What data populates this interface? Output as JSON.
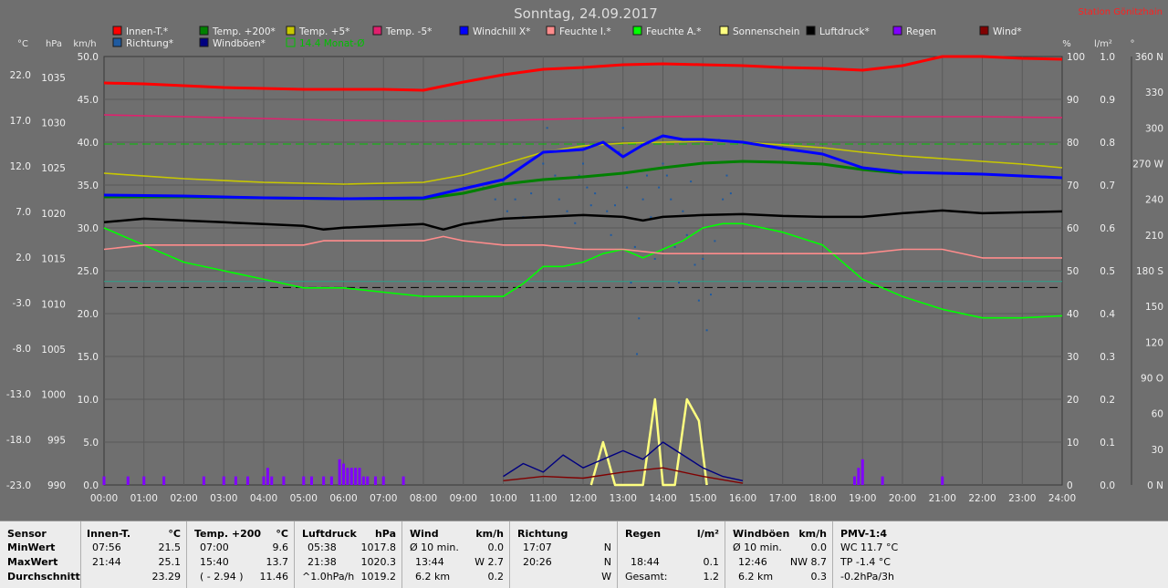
{
  "chart_data": {
    "type": "line",
    "title": "Sonntag, 24.09.2017",
    "station": "Station Gönitzhain",
    "x_ticks": [
      "00:00",
      "01:00",
      "02:00",
      "03:00",
      "04:00",
      "05:00",
      "06:00",
      "07:00",
      "08:00",
      "09:00",
      "10:00",
      "11:00",
      "12:00",
      "13:00",
      "14:00",
      "15:00",
      "16:00",
      "17:00",
      "18:00",
      "19:00",
      "20:00",
      "21:00",
      "22:00",
      "23:00",
      "24:00"
    ],
    "axes_left": {
      "temp_unit": "°C",
      "temp_ticks": [
        "22.0",
        "17.0",
        "12.0",
        "7.0",
        "2.0",
        "-3.0",
        "-8.0",
        "-13.0",
        "-18.0",
        "-23.0"
      ],
      "pressure_unit": "hPa",
      "pressure_ticks": [
        "1035",
        "1030",
        "1025",
        "1020",
        "1015",
        "1010",
        "1005",
        "1000",
        "995",
        "990"
      ],
      "wind_unit": "km/h",
      "wind_ticks": [
        "50.0",
        "45.0",
        "40.0",
        "35.0",
        "30.0",
        "25.0",
        "20.0",
        "15.0",
        "10.0",
        "5.0",
        "0.0"
      ]
    },
    "axes_right": {
      "humidity_unit": "%",
      "humidity_ticks": [
        "100",
        "90",
        "80",
        "70",
        "60",
        "50",
        "40",
        "30",
        "20",
        "10",
        "0"
      ],
      "rain_unit": "l/m²",
      "rain_ticks": [
        "1.0",
        "0.9",
        "0.8",
        "0.7",
        "0.6",
        "0.5",
        "0.4",
        "0.3",
        "0.2",
        "0.1",
        "0.0"
      ],
      "dir_unit": "°",
      "dir_ticks": [
        "360 N",
        "330",
        "300",
        "270 W",
        "240",
        "210",
        "180 S",
        "150",
        "120",
        "90 O",
        "60",
        "30",
        "0 N"
      ]
    },
    "legend": [
      {
        "label": "Innen-T.*",
        "color": "#ff0000"
      },
      {
        "label": "Temp. +200*",
        "color": "#008000"
      },
      {
        "label": "Temp. +5*",
        "color": "#c8c800"
      },
      {
        "label": "Temp. -5*",
        "color": "#e0206e"
      },
      {
        "label": "Windchill X*",
        "color": "#0000ff"
      },
      {
        "label": "Feuchte I.*",
        "color": "#ff8c8c"
      },
      {
        "label": "Feuchte A.*",
        "color": "#00ff00"
      },
      {
        "label": "Sonnenschein",
        "color": "#ffff80"
      },
      {
        "label": "Luftdruck*",
        "color": "#000000"
      },
      {
        "label": "Regen",
        "color": "#8000ff"
      },
      {
        "label": "Wind*",
        "color": "#800000"
      },
      {
        "label": "Richtung*",
        "color": "#1e5aa0"
      },
      {
        "label": "Windböen*",
        "color": "#000080"
      },
      {
        "label": "14.4 Monat-Ø",
        "color": "#00c000"
      }
    ],
    "series": [
      {
        "name": "Innen-T.*",
        "unit": "°C",
        "x": [
          0,
          1,
          2,
          3,
          4,
          5,
          6,
          7,
          8,
          9,
          10,
          11,
          12,
          13,
          14,
          15,
          16,
          17,
          18,
          19,
          20,
          21,
          22,
          23,
          24
        ],
        "values": [
          21.1,
          21.0,
          20.8,
          20.6,
          20.5,
          20.4,
          20.4,
          20.4,
          20.3,
          21.2,
          22.0,
          22.6,
          22.8,
          23.1,
          23.2,
          23.1,
          23.0,
          22.8,
          22.7,
          22.5,
          23.0,
          24.0,
          24.0,
          23.8,
          23.7
        ]
      },
      {
        "name": "Temp. +5*",
        "unit": "°C",
        "x": [
          0,
          2,
          4,
          6,
          8,
          9,
          10,
          11,
          12,
          13,
          14,
          15,
          16,
          17,
          18,
          19,
          20,
          21,
          22,
          23,
          24
        ],
        "values": [
          11.2,
          10.6,
          10.2,
          10.0,
          10.2,
          11.0,
          12.2,
          13.5,
          14.2,
          14.5,
          14.6,
          14.7,
          14.6,
          14.3,
          14.0,
          13.5,
          13.1,
          12.8,
          12.5,
          12.2,
          11.8
        ]
      },
      {
        "name": "Temp. -5*",
        "unit": "°C",
        "x": [
          0,
          2,
          4,
          6,
          8,
          10,
          12,
          14,
          16,
          18,
          20,
          22,
          24
        ],
        "values": [
          17.6,
          17.4,
          17.2,
          17.0,
          16.9,
          17.0,
          17.2,
          17.4,
          17.5,
          17.5,
          17.4,
          17.4,
          17.3
        ]
      },
      {
        "name": "Temp. +200*",
        "unit": "°C",
        "x": [
          0,
          2,
          4,
          6,
          8,
          9,
          10,
          11,
          12,
          13,
          14,
          15,
          16,
          17,
          18,
          19,
          20
        ],
        "values": [
          8.6,
          8.6,
          8.5,
          8.4,
          8.4,
          9.0,
          10.0,
          10.5,
          10.8,
          11.2,
          11.8,
          12.3,
          12.5,
          12.4,
          12.2,
          11.6,
          11.2
        ]
      },
      {
        "name": "Windchill X*",
        "unit": "°C",
        "x": [
          0,
          2,
          4,
          6,
          8,
          9,
          10,
          10.5,
          11,
          12,
          12.5,
          13,
          13.5,
          14,
          14.5,
          15,
          16,
          17,
          18,
          19,
          20,
          22,
          24
        ],
        "values": [
          8.8,
          8.7,
          8.5,
          8.4,
          8.5,
          9.5,
          10.5,
          12.0,
          13.5,
          13.8,
          14.6,
          13.0,
          14.3,
          15.3,
          14.9,
          14.9,
          14.6,
          13.9,
          13.3,
          11.8,
          11.3,
          11.1,
          10.7
        ]
      },
      {
        "name": "Luftdruck*",
        "unit": "hPa",
        "x": [
          0,
          1,
          2,
          3,
          4,
          5,
          5.5,
          6,
          7,
          8,
          8.5,
          9,
          10,
          11,
          12,
          13,
          13.5,
          14,
          15,
          16,
          17,
          18,
          19,
          20,
          21,
          22,
          23,
          24
        ],
        "values": [
          1019.0,
          1019.4,
          1019.2,
          1019.0,
          1018.8,
          1018.6,
          1018.2,
          1018.4,
          1018.6,
          1018.8,
          1018.2,
          1018.8,
          1019.4,
          1019.6,
          1019.8,
          1019.6,
          1019.2,
          1019.6,
          1019.8,
          1019.9,
          1019.7,
          1019.6,
          1019.6,
          1020.0,
          1020.3,
          1020.0,
          1020.1,
          1020.2
        ]
      },
      {
        "name": "Feuchte I.*",
        "unit": "%",
        "x": [
          0,
          1,
          2,
          3,
          4,
          5,
          5.5,
          6,
          7,
          8,
          8.5,
          9,
          10,
          11,
          12,
          13,
          14,
          15,
          16,
          17,
          18,
          19,
          20,
          21,
          22,
          23,
          24
        ],
        "values": [
          55,
          56,
          56,
          56,
          56,
          56,
          57,
          57,
          57,
          57,
          58,
          57,
          56,
          56,
          55,
          55,
          54,
          54,
          54,
          54,
          54,
          54,
          55,
          55,
          53,
          53,
          53
        ]
      },
      {
        "name": "Feuchte A.*",
        "unit": "%",
        "x": [
          0,
          1,
          2,
          3,
          4,
          5,
          6,
          7,
          8,
          9,
          10,
          10.5,
          11,
          11.5,
          12,
          12.5,
          13,
          13.5,
          14,
          14.5,
          15,
          15.5,
          16,
          17,
          18,
          19,
          20,
          21,
          22,
          23,
          24
        ],
        "values": [
          60,
          56,
          52,
          50,
          48,
          46,
          46,
          45,
          44,
          44,
          44,
          47,
          51,
          51,
          52,
          54,
          55,
          53,
          55,
          57,
          60,
          61,
          61,
          59,
          56,
          48,
          44,
          41,
          39,
          39,
          39.5
        ]
      },
      {
        "name": "Sonnenschein",
        "unit": "%",
        "x": [
          12.2,
          12.5,
          12.8,
          13.5,
          13.8,
          14.0,
          14.3,
          14.6,
          14.9,
          15.1
        ],
        "values": [
          0,
          10,
          0,
          0,
          20,
          0,
          0,
          20,
          15,
          0
        ]
      },
      {
        "name": "Wind*",
        "unit": "km/h",
        "x": [
          10,
          11,
          12,
          13,
          14,
          15,
          16
        ],
        "values": [
          0.5,
          1.0,
          0.8,
          1.5,
          2.0,
          1.0,
          0.2
        ]
      },
      {
        "name": "Windböen*",
        "unit": "km/h",
        "x": [
          10,
          10.5,
          11,
          11.5,
          12,
          12.5,
          13,
          13.5,
          14,
          14.5,
          15,
          15.5,
          16
        ],
        "values": [
          1.0,
          2.5,
          1.5,
          3.5,
          2.0,
          3.0,
          4.0,
          3.0,
          5.0,
          3.5,
          2.0,
          1.0,
          0.5
        ]
      },
      {
        "name": "Regen",
        "unit": "l/m²",
        "x": [
          0,
          0.6,
          1.0,
          1.5,
          2.5,
          3.0,
          3.3,
          3.6,
          4.0,
          4.1,
          4.2,
          4.5,
          5.0,
          5.2,
          5.5,
          5.7,
          5.9,
          6.0,
          6.1,
          6.2,
          6.3,
          6.4,
          6.5,
          6.6,
          6.8,
          7.0,
          7.5,
          18.8,
          18.9,
          19.0,
          19.5,
          21.0
        ],
        "values": [
          0.02,
          0.02,
          0.02,
          0.02,
          0.02,
          0.02,
          0.02,
          0.02,
          0.02,
          0.04,
          0.02,
          0.02,
          0.02,
          0.02,
          0.02,
          0.02,
          0.06,
          0.05,
          0.04,
          0.04,
          0.04,
          0.04,
          0.02,
          0.02,
          0.02,
          0.02,
          0.02,
          0.02,
          0.04,
          0.06,
          0.02,
          0.02
        ]
      }
    ],
    "direction_scatter": [
      [
        9.5,
        250
      ],
      [
        9.8,
        240
      ],
      [
        10.0,
        255
      ],
      [
        10.1,
        230
      ],
      [
        10.3,
        240
      ],
      [
        10.5,
        225
      ],
      [
        10.7,
        245
      ],
      [
        11.0,
        270
      ],
      [
        11.1,
        300
      ],
      [
        11.2,
        280
      ],
      [
        11.3,
        260
      ],
      [
        11.4,
        240
      ],
      [
        11.6,
        230
      ],
      [
        11.8,
        220
      ],
      [
        11.9,
        260
      ],
      [
        12.0,
        270
      ],
      [
        12.1,
        250
      ],
      [
        12.2,
        235
      ],
      [
        12.3,
        245
      ],
      [
        12.5,
        260
      ],
      [
        12.6,
        230
      ],
      [
        12.7,
        210
      ],
      [
        12.8,
        235
      ],
      [
        12.9,
        280
      ],
      [
        13.0,
        300
      ],
      [
        13.1,
        250
      ],
      [
        13.2,
        170
      ],
      [
        13.3,
        200
      ],
      [
        13.35,
        110
      ],
      [
        13.4,
        140
      ],
      [
        13.5,
        240
      ],
      [
        13.6,
        260
      ],
      [
        13.7,
        225
      ],
      [
        13.8,
        190
      ],
      [
        13.9,
        250
      ],
      [
        14.0,
        270
      ],
      [
        14.1,
        260
      ],
      [
        14.2,
        240
      ],
      [
        14.3,
        200
      ],
      [
        14.4,
        170
      ],
      [
        14.5,
        230
      ],
      [
        14.6,
        210
      ],
      [
        14.7,
        255
      ],
      [
        14.8,
        185
      ],
      [
        14.9,
        155
      ],
      [
        15.0,
        190
      ],
      [
        15.1,
        130
      ],
      [
        15.2,
        160
      ],
      [
        15.3,
        205
      ],
      [
        15.4,
        290
      ],
      [
        15.5,
        240
      ],
      [
        15.6,
        260
      ],
      [
        15.7,
        245
      ]
    ],
    "reference_lines": [
      {
        "name": "14.4 Monat-Ø",
        "unit": "°C",
        "value": 14.4,
        "color": "#00c000",
        "style": "dashed"
      },
      {
        "name": "Luftdruck ref",
        "unit": "hPa",
        "value": 1011.8,
        "color": "#000000",
        "style": "dashed"
      },
      {
        "name": "Feuchte ref",
        "unit": "%",
        "value": 47.5,
        "color": "#2aa08a",
        "style": "solid"
      }
    ],
    "grid": true
  },
  "table": {
    "row_labels": [
      "Sensor",
      "MinWert",
      "MaxWert",
      "Durchschnitt"
    ],
    "innen": {
      "title": "Innen-T.",
      "unit": "°C",
      "min_time": "07:56",
      "min": "21.5",
      "max_time": "21:44",
      "max": "25.1",
      "avg": "23.29"
    },
    "temp200": {
      "title": "Temp. +200",
      "unit": "°C",
      "min_time": "07:00",
      "min": "9.6",
      "max_time": "15:40",
      "max": "13.7",
      "avg_note": "( - 2.94 )",
      "avg": "11.46"
    },
    "luftdruck": {
      "title": "Luftdruck",
      "unit": "hPa",
      "min_time": "05:38",
      "min": "1017.8",
      "max_time": "21:38",
      "max": "1020.3",
      "avg_note": "^1.0hPa/h",
      "avg": "1019.2"
    },
    "wind": {
      "title": "Wind",
      "unit": "km/h",
      "min_label": "Ø 10 min.",
      "min": "0.0",
      "max_time": "13:44",
      "max": "W 2.7",
      "avg_note": "6.2 km",
      "avg": "0.2"
    },
    "richtung": {
      "title": "Richtung",
      "min_time": "17:07",
      "min": "N",
      "max_time": "20:26",
      "max": "N",
      "avg": "W"
    },
    "regen": {
      "title": "Regen",
      "unit": "l/m²",
      "max_time": "18:44",
      "max": "0.1",
      "avg_label": "Gesamt:",
      "avg": "1.2"
    },
    "windboeen": {
      "title": "Windböen",
      "unit": "km/h",
      "min_label": "Ø 10 min.",
      "min": "0.0",
      "max_time": "12:46",
      "max": "NW 8.7",
      "avg_note": "6.2 km",
      "avg": "0.3"
    },
    "pmv": {
      "title": "PMV-1:4",
      "min": "WC 11.7 °C",
      "max": "TP -1.4 °C",
      "avg": "-0.2hPa/3h"
    }
  }
}
